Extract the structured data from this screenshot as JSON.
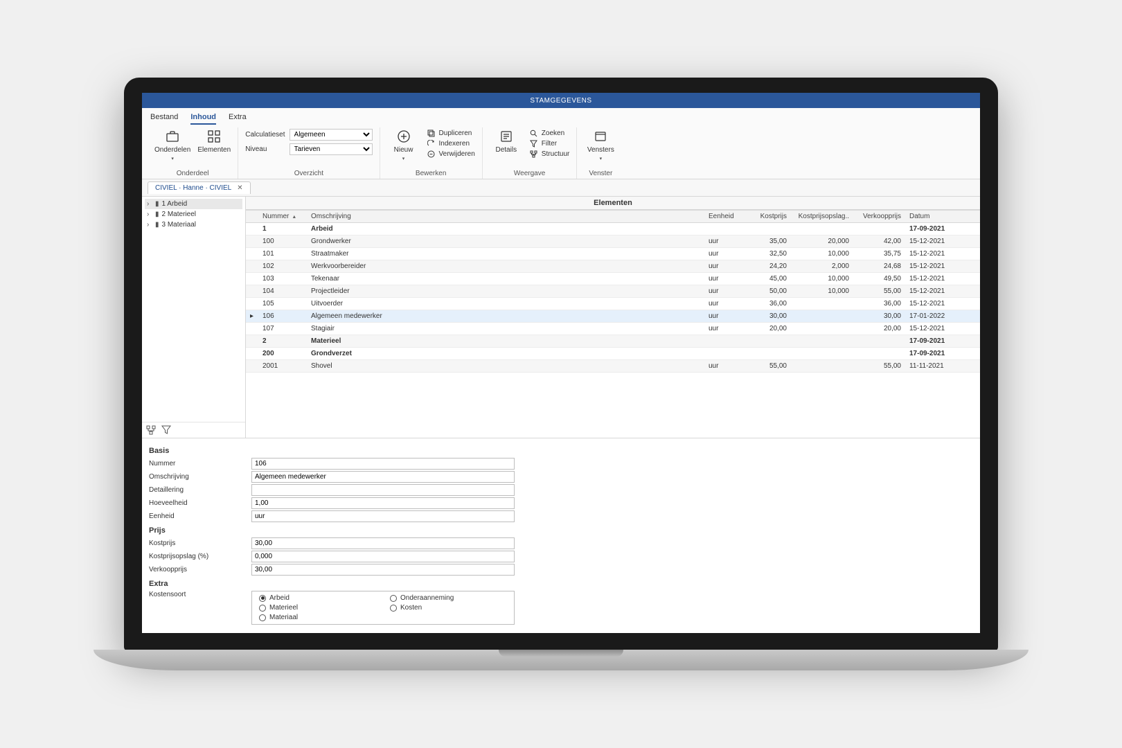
{
  "title": "STAMGEGEVENS",
  "menu": {
    "bestand": "Bestand",
    "inhoud": "Inhoud",
    "extra": "Extra"
  },
  "ribbon": {
    "onderdeel": {
      "onderdelen": "Onderdelen",
      "elementen": "Elementen",
      "label": "Onderdeel"
    },
    "overzicht": {
      "calculatieset_lbl": "Calculatieset",
      "calculatieset_val": "Algemeen",
      "niveau_lbl": "Niveau",
      "niveau_val": "Tarieven",
      "label": "Overzicht"
    },
    "bewerken": {
      "nieuw": "Nieuw",
      "dupliceren": "Dupliceren",
      "indexeren": "Indexeren",
      "verwijderen": "Verwijderen",
      "label": "Bewerken"
    },
    "weergave": {
      "details": "Details",
      "zoeken": "Zoeken",
      "filter": "Filter",
      "structuur": "Structuur",
      "label": "Weergave"
    },
    "venster": {
      "vensters": "Vensters",
      "label": "Venster"
    }
  },
  "doc_tab": {
    "label": "CIVIEL · Hanne · CIVIEL",
    "close": "✕"
  },
  "tree": {
    "items": [
      {
        "label": "1  Arbeid"
      },
      {
        "label": "2  Materieel"
      },
      {
        "label": "3  Materiaal"
      }
    ]
  },
  "grid": {
    "title": "Elementen",
    "cols": {
      "nummer": "Nummer",
      "omschrijving": "Omschrijving",
      "eenheid": "Eenheid",
      "kostprijs": "Kostprijs",
      "kostprijsopslag": "Kostprijsopslag..",
      "verkoopprijs": "Verkoopprijs",
      "datum": "Datum"
    },
    "rows": [
      {
        "n": "1",
        "o": "Arbeid",
        "e": "",
        "k": "",
        "ko": "",
        "v": "",
        "d": "17-09-2021",
        "bold": true
      },
      {
        "n": "100",
        "o": "Grondwerker",
        "e": "uur",
        "k": "35,00",
        "ko": "20,000",
        "v": "42,00",
        "d": "15-12-2021"
      },
      {
        "n": "101",
        "o": "Straatmaker",
        "e": "uur",
        "k": "32,50",
        "ko": "10,000",
        "v": "35,75",
        "d": "15-12-2021"
      },
      {
        "n": "102",
        "o": "Werkvoorbereider",
        "e": "uur",
        "k": "24,20",
        "ko": "2,000",
        "v": "24,68",
        "d": "15-12-2021"
      },
      {
        "n": "103",
        "o": "Tekenaar",
        "e": "uur",
        "k": "45,00",
        "ko": "10,000",
        "v": "49,50",
        "d": "15-12-2021"
      },
      {
        "n": "104",
        "o": "Projectleider",
        "e": "uur",
        "k": "50,00",
        "ko": "10,000",
        "v": "55,00",
        "d": "15-12-2021"
      },
      {
        "n": "105",
        "o": "Uitvoerder",
        "e": "uur",
        "k": "36,00",
        "ko": "",
        "v": "36,00",
        "d": "15-12-2021"
      },
      {
        "n": "106",
        "o": "Algemeen medewerker",
        "e": "uur",
        "k": "30,00",
        "ko": "",
        "v": "30,00",
        "d": "17-01-2022",
        "selected": true
      },
      {
        "n": "107",
        "o": "Stagiair",
        "e": "uur",
        "k": "20,00",
        "ko": "",
        "v": "20,00",
        "d": "15-12-2021"
      },
      {
        "n": "2",
        "o": "Materieel",
        "e": "",
        "k": "",
        "ko": "",
        "v": "",
        "d": "17-09-2021",
        "bold": true
      },
      {
        "n": "200",
        "o": "Grondverzet",
        "e": "",
        "k": "",
        "ko": "",
        "v": "",
        "d": "17-09-2021",
        "bold": true
      },
      {
        "n": "2001",
        "o": "Shovel",
        "e": "uur",
        "k": "55,00",
        "ko": "",
        "v": "55,00",
        "d": "11-11-2021"
      }
    ]
  },
  "detail": {
    "basis_h": "Basis",
    "nummer_lbl": "Nummer",
    "nummer_val": "106",
    "omschrijving_lbl": "Omschrijving",
    "omschrijving_val": "Algemeen medewerker",
    "detaillering_lbl": "Detaillering",
    "detaillering_val": "",
    "hoeveelheid_lbl": "Hoeveelheid",
    "hoeveelheid_val": "1,00",
    "eenheid_lbl": "Eenheid",
    "eenheid_val": "uur",
    "prijs_h": "Prijs",
    "kostprijs_lbl": "Kostprijs",
    "kostprijs_val": "30,00",
    "kostprijsopslag_lbl": "Kostprijsopslag (%)",
    "kostprijsopslag_val": "0,000",
    "verkoopprijs_lbl": "Verkoopprijs",
    "verkoopprijs_val": "30,00",
    "extra_h": "Extra",
    "kostensoort_lbl": "Kostensoort",
    "radio": {
      "arbeid": "Arbeid",
      "onderaanneming": "Onderaanneming",
      "materieel": "Materieel",
      "kosten": "Kosten",
      "materiaal": "Materiaal"
    }
  }
}
